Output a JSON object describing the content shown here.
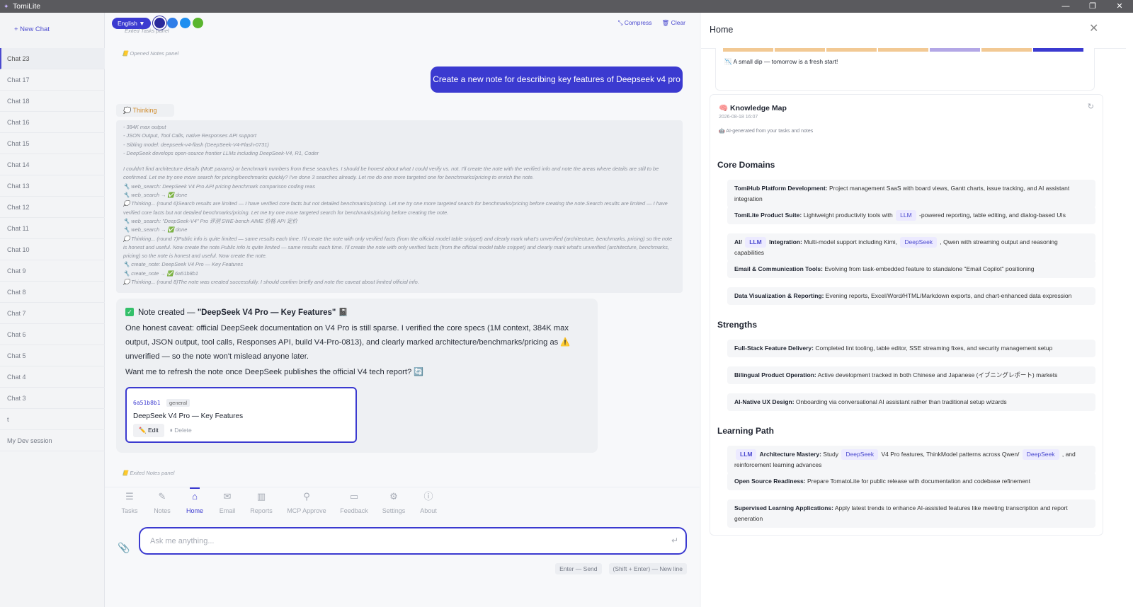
{
  "window": {
    "title": "TomiLite",
    "controls": [
      "—",
      "❐",
      "✕"
    ]
  },
  "sidebar": {
    "new_chat": "+ New Chat",
    "chats": [
      "Chat 23",
      "Chat 17",
      "Chat 18",
      "Chat 16",
      "Chat 15",
      "Chat 14",
      "Chat 13",
      "Chat 12",
      "Chat 11",
      "Chat 10",
      "Chat 9",
      "Chat 8",
      "Chat 7",
      "Chat 6",
      "Chat 5",
      "Chat 4",
      "Chat 3",
      "t",
      "My Dev session"
    ],
    "active_index": 0
  },
  "topbar": {
    "language": "English ▼",
    "colors": [
      "#2b2a9c",
      "#2f7de8",
      "#1f8ff0",
      "#5ab52e"
    ],
    "compress": "⤡ Compress",
    "clear": "🗑 Clear"
  },
  "messages": {
    "sys_exited_top": "Exited Tasks panel",
    "sys_opened": "📒 Opened Notes panel",
    "user_message": "Create a new note for describing key features of Deepseek v4 pro",
    "thinking_label": "💭 Thinking",
    "thinking_lines": [
      "- 384K max output",
      "- JSON Output, Tool Calls, native Responses API support",
      "- Sibling model: deepseek-v4-flash (DeepSeek-V4-Flash-0731)",
      "- DeepSeek develops open-source frontier LLMs including DeepSeek-V4, R1, Coder",
      "",
      "I couldn't find architecture details (MoE params) or benchmark numbers from these searches. I should be honest about what I could verify vs. not. I'll create the note with the verified info and note the areas where details are still to be confirmed. Let me try one more search for pricing/benchmarks quickly? I've done 3 searches already. Let me do one more targeted one for benchmarks/pricing to enrich the note.",
      "🔧 web_search: DeepSeek V4 Pro API pricing benchmark comparison coding reas",
      "🔧 web_search → ✅ done",
      "💭 Thinking... (round 6)Search results are limited — I have verified core facts but not detailed benchmarks/pricing. Let me try one more targeted search for benchmarks/pricing before creating the note.Search results are limited — I have verified core facts but not detailed benchmarks/pricing. Let me try one more targeted search for benchmarks/pricing before creating the note.",
      "🔧 web_search: \"DeepSeek-V4\" Pro 评测 SWE-bench AIME 价格 API 定价",
      "🔧 web_search → ✅ done",
      "💭 Thinking... (round 7)Public info is quite limited — same results each time. I'll create the note with only verified facts (from the official model table snippet) and clearly mark what's unverified (architecture, benchmarks, pricing) so the note is honest and useful. Now create the note.Public info is quite limited — same results each time. I'll create the note with only verified facts (from the official model table snippet) and clearly mark what's unverified (architecture, benchmarks, pricing) so the note is honest and useful. Now create the note.",
      "🔧 create_note: DeepSeek V4 Pro — Key Features",
      "🔧 create_note → ✅ 6a51b8b1",
      "💭 Thinking... (round 8)The note was created successfully. I should confirm briefly and note the caveat about limited official info."
    ],
    "assistant": {
      "title_prefix": "Note created — ",
      "title_quote": "\"DeepSeek V4 Pro — Key Features\"",
      "title_suffix": "📓",
      "paragraph1": "One honest caveat: official DeepSeek documentation on V4 Pro is still sparse. I verified the core specs (1M context, 384K max output, JSON output, tool calls, Responses API, build V4-Pro-0813), and clearly marked architecture/benchmarks/pricing as ⚠️ unverified — so the note won't mislead anyone later.",
      "paragraph2": "Want me to refresh the note once DeepSeek publishes the official V4 tech report? 🔄"
    },
    "note_card": {
      "id": "6a51b8b1",
      "category": "general",
      "title": "DeepSeek V4 Pro — Key Features",
      "edit": "✏️ Edit",
      "delete": "⏸ Delete"
    },
    "sys_exited_bottom": "📒 Exited Notes panel"
  },
  "nav": [
    {
      "label": "Tasks",
      "icon": "☰"
    },
    {
      "label": "Notes",
      "icon": "✎"
    },
    {
      "label": "Home",
      "icon": "⌂"
    },
    {
      "label": "Email",
      "icon": "✉"
    },
    {
      "label": "Reports",
      "icon": "▥"
    },
    {
      "label": "MCP Approve",
      "icon": "⚲"
    },
    {
      "label": "Feedback",
      "icon": "▭"
    },
    {
      "label": "Settings",
      "icon": "⚙"
    },
    {
      "label": "About",
      "icon": "ⓘ"
    }
  ],
  "nav_active_index": 2,
  "input": {
    "placeholder": "Ask me anything...",
    "value": "",
    "hint_send": "Enter — Send",
    "hint_newline": "(Shift + Enter) — New line"
  },
  "right_panel": {
    "title": "Home",
    "mood_colors": [
      "#f2c994",
      "#f2c994",
      "#f2c994",
      "#f2c994",
      "#b3a7e6",
      "#f2c994",
      "#3b3ad0"
    ],
    "mood_text": "📉 A small dip — tomorrow is a fresh start!",
    "kmap": {
      "title": "🧠 Knowledge Map",
      "date": "2026-08-18 16:07",
      "subtitle": "🤖 AI-generated from your tasks and notes",
      "sections": [
        {
          "title": "Core Domains",
          "items": [
            {
              "head": "TomiHub Platform Development:",
              "text": "Project management SaaS with board views, Gantt charts, issue tracking, and AI assistant integration"
            },
            {
              "head": "TomiLite Product Suite:",
              "text": "Lightweight productivity tools with LLM -powered reporting, table editing, and dialog-based UIs"
            },
            {
              "head": "AI/ LLM Integration:",
              "text": "Multi-model support including Kimi, DeepSeek , Qwen with streaming output and reasoning capabilities"
            },
            {
              "head": "Email & Communication Tools:",
              "text": "Evolving from task-embedded feature to standalone \"Email Copilot\" positioning"
            },
            {
              "head": "Data Visualization & Reporting:",
              "text": "Evening reports, Excel/Word/HTML/Markdown exports, and chart-enhanced data expression"
            }
          ]
        },
        {
          "title": "Strengths",
          "items": [
            {
              "head": "Full-Stack Feature Delivery:",
              "text": "Completed lint tooling, table editor, SSE streaming fixes, and security management setup"
            },
            {
              "head": "Bilingual Product Operation:",
              "text": "Active development tracked in both Chinese and Japanese (イブニングレポート) markets"
            },
            {
              "head": "AI-Native UX Design:",
              "text": "Onboarding via conversational AI assistant rather than traditional setup wizards"
            }
          ]
        },
        {
          "title": "Learning Path",
          "items": [
            {
              "head": "LLM Architecture Mastery:",
              "text": "Study DeepSeek V4 Pro features, ThinkModel patterns across Qwen/ DeepSeek , and reinforcement learning advances"
            },
            {
              "head": "Open Source Readiness:",
              "text": "Prepare TomatoLite for public release with documentation and codebase refinement"
            },
            {
              "head": "Supervised Learning Applications:",
              "text": "Apply latest trends to enhance AI-assisted features like meeting transcription and report generation"
            }
          ]
        }
      ]
    }
  }
}
